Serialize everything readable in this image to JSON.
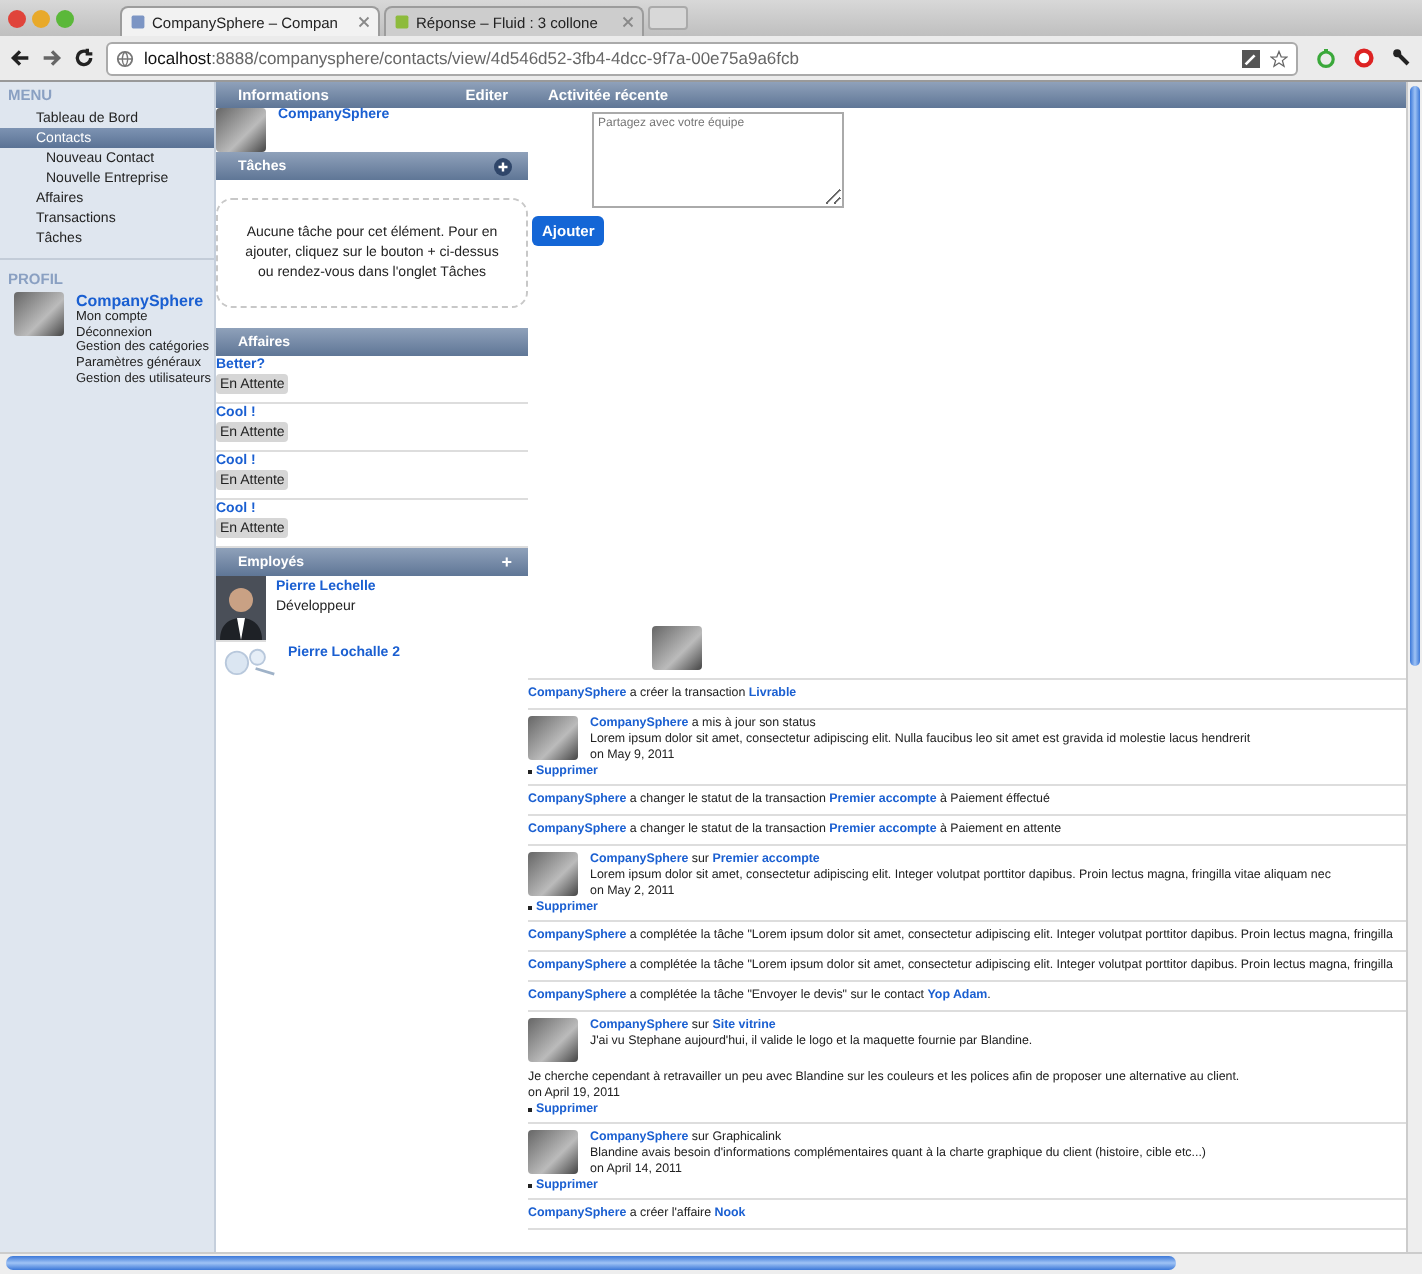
{
  "browser": {
    "tabs": [
      {
        "title": "CompanySphere – Compan",
        "selected": true
      },
      {
        "title": "Réponse – Fluid : 3 collone",
        "selected": false
      }
    ],
    "url_host": "localhost",
    "url_rest": ":8888/companysphere/contacts/view/4d546d52-3fb4-4dcc-9f7a-00e75a9a6fcb"
  },
  "sidebar": {
    "menu_title": "MENU",
    "menu": [
      {
        "label": "Tableau de Bord",
        "selected": false
      },
      {
        "label": "Contacts",
        "selected": true,
        "children": [
          {
            "label": "Nouveau Contact",
            "selected": false
          },
          {
            "label": "Nouvelle Entreprise",
            "selected": false
          }
        ]
      },
      {
        "label": "Affaires",
        "selected": false
      },
      {
        "label": "Transactions",
        "selected": false
      },
      {
        "label": "Tâches",
        "selected": false
      }
    ],
    "profile_title": "PROFIL",
    "profile_name": "CompanySphere",
    "profile_links": [
      "Mon compte",
      "Déconnexion",
      "Gestion des catégories",
      "Paramètres généraux",
      "Gestion des utilisateurs"
    ]
  },
  "header": {
    "info": "Informations",
    "edit": "Editer",
    "activity": "Activitée récente"
  },
  "contact": {
    "name": "CompanySphere"
  },
  "tasks": {
    "title": "Tâches",
    "empty_text": "Aucune tâche pour cet élément. Pour en ajouter, cliquez sur le bouton + ci-dessus ou rendez-vous dans l'onglet Tâches"
  },
  "deals": {
    "title": "Affaires",
    "items": [
      {
        "name": "Better?",
        "status": "En Attente"
      },
      {
        "name": "Cool !",
        "status": "En Attente"
      },
      {
        "name": "Cool !",
        "status": "En Attente"
      },
      {
        "name": "Cool !",
        "status": "En Attente"
      }
    ]
  },
  "employees": {
    "title": "Employés",
    "add": "+",
    "items": [
      {
        "kind": "photo",
        "name": "Pierre Lechelle",
        "role": "Développeur"
      },
      {
        "kind": "generic",
        "name": "Pierre Lochalle 2"
      }
    ]
  },
  "share": {
    "placeholder": "Partagez avec votre équipe",
    "button": "Ajouter"
  },
  "feed": [
    {
      "kind": "line",
      "parts": [
        {
          "text": "CompanySphere",
          "link": true
        },
        {
          "text": " a créer la transaction ",
          "link": false
        },
        {
          "text": "Livrable",
          "link": true
        }
      ]
    },
    {
      "kind": "post",
      "parts": [
        {
          "text": "CompanySphere",
          "link": true
        },
        {
          "text": " a mis à jour son status",
          "link": false
        }
      ],
      "body": "Lorem ipsum dolor sit amet, consectetur adipiscing elit. Nulla faucibus leo sit amet est gravida id molestie lacus hendrerit",
      "date": "on May 9, 2011",
      "delete": "Supprimer"
    },
    {
      "kind": "line",
      "parts": [
        {
          "text": "CompanySphere",
          "link": true
        },
        {
          "text": " a changer le statut de la transaction ",
          "link": false
        },
        {
          "text": "Premier accompte",
          "link": true
        },
        {
          "text": " à Paiement éffectué",
          "link": false
        }
      ]
    },
    {
      "kind": "line",
      "parts": [
        {
          "text": "CompanySphere",
          "link": true
        },
        {
          "text": " a changer le statut de la transaction ",
          "link": false
        },
        {
          "text": "Premier accompte",
          "link": true
        },
        {
          "text": " à Paiement en attente",
          "link": false
        }
      ]
    },
    {
      "kind": "post",
      "parts": [
        {
          "text": "CompanySphere",
          "link": true
        },
        {
          "text": " sur ",
          "link": false
        },
        {
          "text": "Premier accompte",
          "link": true
        }
      ],
      "body": "Lorem ipsum dolor sit amet, consectetur adipiscing elit. Integer volutpat porttitor dapibus. Proin lectus magna, fringilla vitae aliquam nec",
      "date": "on May 2, 2011",
      "delete": "Supprimer"
    },
    {
      "kind": "line",
      "parts": [
        {
          "text": "CompanySphere",
          "link": true
        },
        {
          "text": " a complétée la tâche \"Lorem ipsum dolor sit amet, consectetur adipiscing elit. Integer volutpat porttitor dapibus. Proin lectus magna, fringilla",
          "link": false
        }
      ]
    },
    {
      "kind": "line",
      "parts": [
        {
          "text": "CompanySphere",
          "link": true
        },
        {
          "text": " a complétée la tâche \"Lorem ipsum dolor sit amet, consectetur adipiscing elit. Integer volutpat porttitor dapibus. Proin lectus magna, fringilla",
          "link": false
        }
      ]
    },
    {
      "kind": "line",
      "parts": [
        {
          "text": "CompanySphere",
          "link": true
        },
        {
          "text": " a complétée la tâche \"Envoyer le devis\" sur le contact ",
          "link": false
        },
        {
          "text": "Yop Adam",
          "link": true
        },
        {
          "text": ".",
          "link": false
        }
      ]
    },
    {
      "kind": "post",
      "parts": [
        {
          "text": "CompanySphere",
          "link": true
        },
        {
          "text": " sur ",
          "link": false
        },
        {
          "text": "Site vitrine",
          "link": true
        }
      ],
      "body": "J'ai vu Stephane aujourd'hui, il valide le logo et la maquette fournie par Blandine.",
      "extra": "Je cherche cependant à retravailler un peu avec Blandine sur les couleurs et les polices afin de proposer une alternative au client.",
      "date": "on April 19, 2011",
      "delete": "Supprimer"
    },
    {
      "kind": "post",
      "parts": [
        {
          "text": "CompanySphere",
          "link": true
        },
        {
          "text": " sur Graphicalink",
          "link": false
        }
      ],
      "body": "Blandine avais besoin d'informations complémentaires quant à la charte graphique du client (histoire, cible etc...)",
      "date": "on April 14, 2011",
      "delete": "Supprimer"
    },
    {
      "kind": "line",
      "parts": [
        {
          "text": "CompanySphere",
          "link": true
        },
        {
          "text": " a créer l'affaire ",
          "link": false
        },
        {
          "text": "Nook",
          "link": true
        }
      ]
    }
  ]
}
